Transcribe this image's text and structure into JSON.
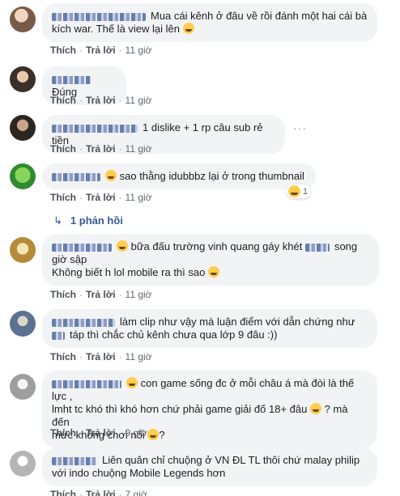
{
  "actions": {
    "like": "Thích",
    "reply": "Trả lời",
    "separator": "·"
  },
  "comments": [
    {
      "text_line1": "Mua cái kênh ở đâu về rồi đánh một hai cái bà",
      "text_line2": "kích war. Thế là view lại lên",
      "emoji": "grin-sweat-emoji",
      "time": "11 giờ",
      "avatar_color": "#c9a48a"
    },
    {
      "text_line1": "Đúng",
      "time": "11 giờ",
      "avatar_color": "#7a6a5c"
    },
    {
      "text_line1": "1 dislike + 1 rp câu sub rẻ tiền",
      "time": "11 giờ",
      "avatar_color": "#4a3f36"
    },
    {
      "text_line1": "sao thằng idubbbz lại ở trong thumbnail",
      "time": "11 giờ",
      "avatar_color": "#3fae49",
      "reaction_count": "1"
    },
    {
      "text_line1": "bữa đấu trường vinh quang gáy khét",
      "text_line1b": "song",
      "text_line2": "giờ sập",
      "text_line3": "Không biết h lol mobile ra thì sao",
      "time": "11 giờ",
      "avatar_color": "#d4b06a"
    },
    {
      "text_line1": "làm clip như vậy mà luận điểm với dẫn chứng như",
      "text_line2": "táp thì chắc chủ kênh chưa qua lớp 9 đâu :))",
      "time": "11 giờ",
      "avatar_color": "#6f86a6"
    },
    {
      "text_line1": "con game sống đc ở mỗi châu á mà đòi là thế lực ,",
      "text_line2": "lmht tc khó thì khó hơn chứ phải game giải đố 18+ đâu",
      "text_line2b": "? mà đến",
      "text_line3": "mức không chơi nổi",
      "text_line3b": "?",
      "time": "9 giờ",
      "avatar_color": "#b8b8b8"
    },
    {
      "text_line1": "Liên quân chỉ chuộng ở VN ĐL TL thôi chứ malay philip",
      "text_line2": "với indo chuộng Mobile Legends hơn",
      "time": "7 giờ",
      "avatar_color": "#cfcfcf"
    }
  ],
  "replies_link": "1 phản hồi",
  "more_options": "···"
}
